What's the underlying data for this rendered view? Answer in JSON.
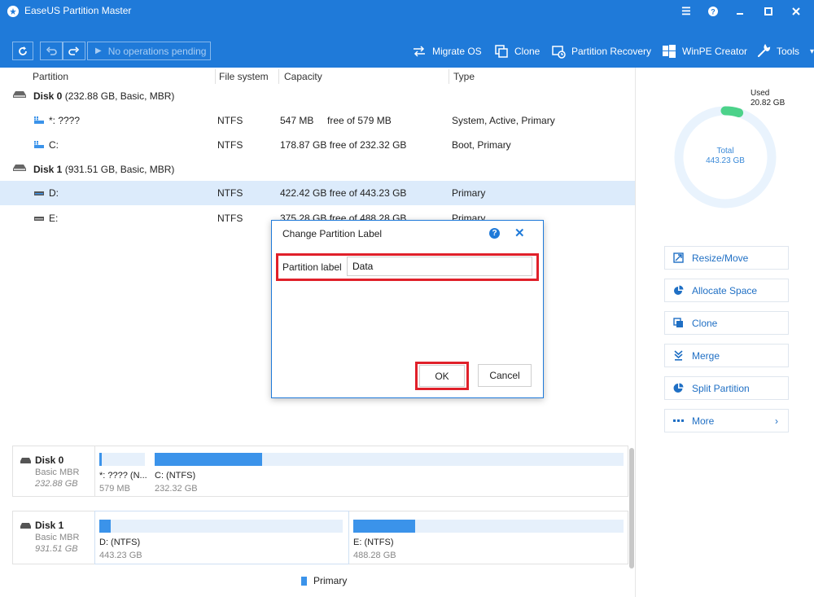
{
  "app": {
    "title": "EaseUS Partition Master"
  },
  "toolbar": {
    "pending_label": "No operations pending",
    "nav": [
      {
        "label": "Migrate OS",
        "icon": "migrate-icon"
      },
      {
        "label": "Clone",
        "icon": "clone-icon"
      },
      {
        "label": "Partition Recovery",
        "icon": "recovery-icon"
      },
      {
        "label": "WinPE Creator",
        "icon": "windows-icon"
      },
      {
        "label": "Tools",
        "icon": "wrench-icon"
      }
    ]
  },
  "list": {
    "columns": [
      "Partition",
      "File system",
      "Capacity",
      "Type"
    ],
    "rows": [
      {
        "kind": "disk",
        "name": "Disk 0",
        "detail": "(232.88 GB, Basic, MBR)"
      },
      {
        "kind": "partition",
        "name": "*: ????",
        "fs": "NTFS",
        "capacity": "547 MB",
        "free": "free of 579 MB",
        "type": "System, Active, Primary"
      },
      {
        "kind": "partition",
        "name": "C:",
        "fs": "NTFS",
        "capacity": "178.87 GB free of 232.32 GB",
        "type": "Boot, Primary"
      },
      {
        "kind": "disk",
        "name": "Disk 1",
        "detail": "(931.51 GB, Basic, MBR)"
      },
      {
        "kind": "partition",
        "name": "D:",
        "fs": "NTFS",
        "capacity": "422.42 GB free of 443.23 GB",
        "type": "Primary",
        "selected": true
      },
      {
        "kind": "partition",
        "name": "E:",
        "fs": "NTFS",
        "capacity": "375.28 GB free of 488.28 GB",
        "type": "Primary"
      }
    ]
  },
  "usage": {
    "used_label": "Used",
    "used_value": "20.82 GB",
    "total_label": "Total",
    "total_value": "443.23 GB",
    "used_fraction": 0.047
  },
  "operations": [
    {
      "label": "Resize/Move",
      "icon": "resize-icon"
    },
    {
      "label": "Allocate Space",
      "icon": "pie-icon"
    },
    {
      "label": "Clone",
      "icon": "clone-icon"
    },
    {
      "label": "Merge",
      "icon": "merge-icon"
    },
    {
      "label": "Split Partition",
      "icon": "split-icon"
    },
    {
      "label": "More",
      "icon": "more-icon"
    }
  ],
  "diskmap": [
    {
      "name": "Disk 0",
      "type": "Basic MBR",
      "size": "232.88 GB",
      "partitions": [
        {
          "label": "*: ???? (N...",
          "size": "579 MB",
          "used_fraction": 0.05
        },
        {
          "label": "C: (NTFS)",
          "size": "232.32 GB",
          "used_fraction": 0.23
        }
      ]
    },
    {
      "name": "Disk 1",
      "type": "Basic MBR",
      "size": "931.51 GB",
      "partitions": [
        {
          "label": "D: (NTFS)",
          "size": "443.23 GB",
          "used_fraction": 0.047
        },
        {
          "label": "E: (NTFS)",
          "size": "488.28 GB",
          "used_fraction": 0.23
        }
      ]
    }
  ],
  "legend": {
    "primary": "Primary"
  },
  "dialog": {
    "title": "Change Partition Label",
    "field_label": "Partition label",
    "field_value": "Data",
    "ok": "OK",
    "cancel": "Cancel"
  },
  "colors": {
    "accent": "#1f7ad9",
    "bar": "#3b93ea",
    "used": "#4cd28a",
    "highlight": "#e0202a"
  }
}
